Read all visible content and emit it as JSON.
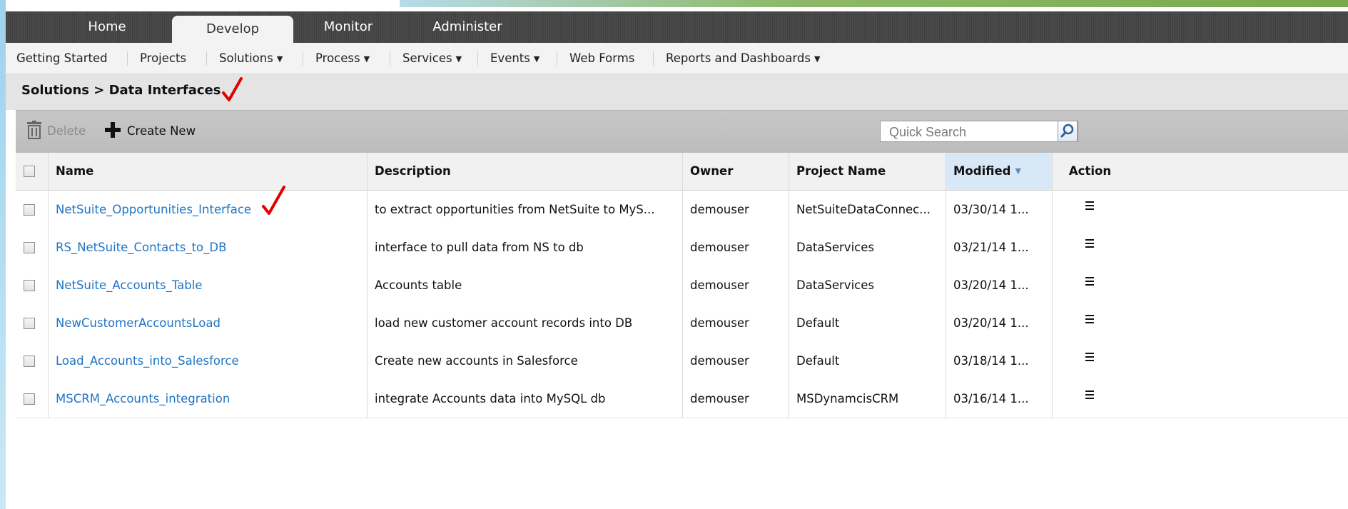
{
  "top_tabs": [
    "Home",
    "Develop",
    "Monitor",
    "Administer"
  ],
  "sub_nav": {
    "getting_started": "Getting Started",
    "projects": "Projects",
    "solutions": "Solutions",
    "process": "Process",
    "services": "Services",
    "events": "Events",
    "web_forms": "Web Forms",
    "reports": "Reports and Dashboards"
  },
  "breadcrumb": "Solutions > Data Interfaces",
  "toolbar": {
    "delete_label": "Delete",
    "create_label": "Create New",
    "search_placeholder": "Quick Search"
  },
  "columns": {
    "name": "Name",
    "description": "Description",
    "owner": "Owner",
    "project": "Project Name",
    "modified": "Modified",
    "action": "Action"
  },
  "rows": [
    {
      "name": "NetSuite_Opportunities_Interface",
      "description": "to extract opportunities from NetSuite to MyS...",
      "owner": "demouser",
      "project": "NetSuiteDataConnec...",
      "modified": "03/30/14 1..."
    },
    {
      "name": "RS_NetSuite_Contacts_to_DB",
      "description": "interface to pull data from NS to db",
      "owner": "demouser",
      "project": "DataServices",
      "modified": "03/21/14 1..."
    },
    {
      "name": "NetSuite_Accounts_Table",
      "description": "Accounts table",
      "owner": "demouser",
      "project": "DataServices",
      "modified": "03/20/14 1..."
    },
    {
      "name": "NewCustomerAccountsLoad",
      "description": "load new customer account records into DB",
      "owner": "demouser",
      "project": "Default",
      "modified": "03/20/14 1..."
    },
    {
      "name": "Load_Accounts_into_Salesforce",
      "description": "Create new accounts in Salesforce",
      "owner": "demouser",
      "project": "Default",
      "modified": "03/18/14 1..."
    },
    {
      "name": "MSCRM_Accounts_integration",
      "description": "integrate Accounts data into MySQL db",
      "owner": "demouser",
      "project": "MSDynamcisCRM",
      "modified": "03/16/14 1..."
    }
  ],
  "colors": {
    "link": "#1f74c4",
    "annotation": "#e00000",
    "modified_header": "#d9e8f7"
  },
  "icons": {
    "delete": "trash-icon",
    "create": "plus-icon",
    "search": "search-icon",
    "sort": "sort-desc-icon",
    "action": "hamburger-menu-icon"
  }
}
